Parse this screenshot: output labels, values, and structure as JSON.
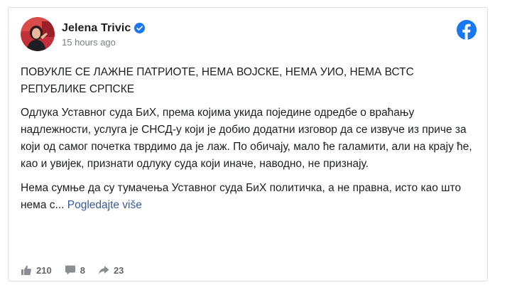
{
  "post": {
    "author": "Jelena Trivic",
    "timestamp": "15 hours ago",
    "headline": "ПОВУКЛЕ СЕ ЛАЖНЕ ПАТРИОТЕ, НЕМА ВОЈСКЕ, НЕМА УИО, НЕМА ВСТС РЕПУБЛИКЕ СРПСКЕ",
    "paragraph1": "Одлука Уставног суда БиХ, према којима укида поједине одредбе о враћању надлежности, услуга је СНСД-у који је добио додатни изговор да се извуче из приче за који од самог почетка тврдимо да је лаж. По обичају, мало ће галамити, али на крају ће, као и увијек, признати одлуку суда који иначе, наводно, не признају.",
    "paragraph2": "Нема сумње да су тумачења Уставног суда БиХ политичка, а не правна, исто као што нема с...",
    "see_more": "Pogledajte više"
  },
  "footer": {
    "likes": "210",
    "comments": "8",
    "shares": "23"
  },
  "colors": {
    "facebook_blue": "#1877f2",
    "verified_blue": "#1877f2",
    "link": "#385898",
    "muted_text": "#65676b"
  },
  "icons": {
    "brand": "facebook-icon",
    "verified": "verified-badge-icon",
    "like": "thumbs-up-icon",
    "comment": "comment-bubble-icon",
    "share": "share-arrow-icon"
  }
}
